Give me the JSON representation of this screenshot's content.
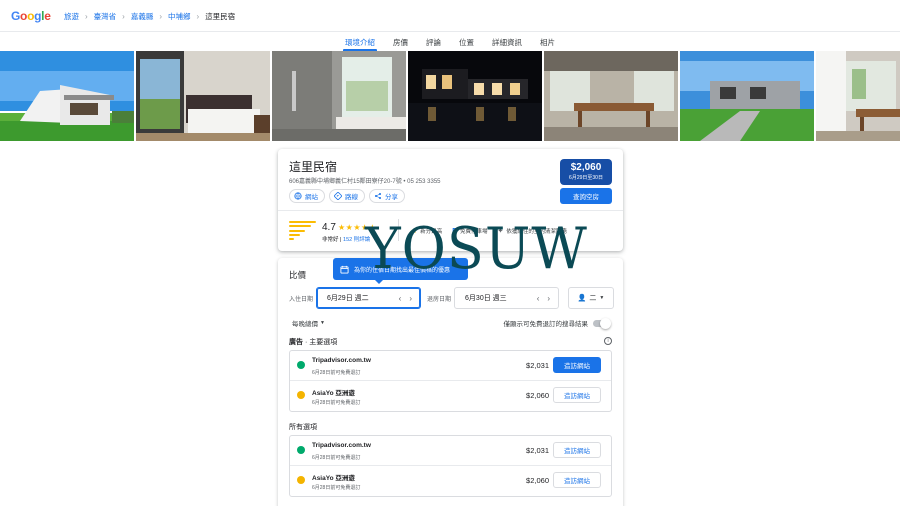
{
  "header": {
    "logo": "Google",
    "breadcrumbs": [
      "旅遊",
      "臺灣省",
      "嘉義縣",
      "中埔鄉",
      "這里民宿"
    ]
  },
  "tabs": [
    {
      "label": "環境介紹",
      "active": true
    },
    {
      "label": "房價",
      "active": false
    },
    {
      "label": "評論",
      "active": false
    },
    {
      "label": "位置",
      "active": false
    },
    {
      "label": "詳細資訊",
      "active": false
    },
    {
      "label": "相片",
      "active": false
    }
  ],
  "hotel": {
    "name": "這里民宿",
    "address": "606嘉義縣中埔鄉義仁村15鄰田寮仔20-7號 • 05 253 3355",
    "chips": {
      "website": "網站",
      "directions": "路線",
      "share": "分享"
    },
    "price": "$2,060",
    "price_dates": "6月29日至30日",
    "check_button": "查詢空房",
    "rating": "4.7",
    "stars": "★★★★★",
    "rating_label": "非常好",
    "review_count": "152 則評論",
    "amenities": [
      "新分最高",
      "免費停車場",
      "依獲經住的室内清潔服務"
    ]
  },
  "pricing": {
    "title": "比價",
    "tooltip": "為你的住宿日期找出最佳價格的優惠",
    "checkin_label": "入住日期",
    "checkin_value": "6月29日 週二",
    "checkout_label": "退房日期",
    "checkout_value": "6月30日 週三",
    "guests": "二",
    "nightly_label": "每晚總價",
    "free_cancel_label": "僅顯示可免費退訂的搜尋結果",
    "ads_heading_bold": "廣告",
    "ads_heading_rest": " · 主要選項",
    "all_heading": "所有選項",
    "ad_offers": [
      {
        "name": "Tripadvisor.com.tw",
        "note": "6月28日前可免費退訂",
        "price": "$2,031",
        "button": "造訪網站",
        "primary": true,
        "logo_color": "#00aa6c"
      },
      {
        "name": "AsiaYo 亞洲遊",
        "note": "6月28日前可免費退訂",
        "price": "$2,060",
        "button": "造訪網站",
        "primary": false,
        "logo_color": "#f4b400"
      }
    ],
    "all_offers": [
      {
        "name": "Tripadvisor.com.tw",
        "note": "6月28日前可免費退訂",
        "price": "$2,031",
        "button": "造訪網站",
        "primary": false,
        "logo_color": "#00aa6c"
      },
      {
        "name": "AsiaYo 亞洲遊",
        "note": "6月28日前可免費退訂",
        "price": "$2,060",
        "button": "造訪網站",
        "primary": false,
        "logo_color": "#f4b400"
      }
    ]
  },
  "watermark": "YOSUW",
  "colors": {
    "accent": "#1a73e8",
    "price_badge": "#174ea6",
    "star": "#fbbc04"
  }
}
